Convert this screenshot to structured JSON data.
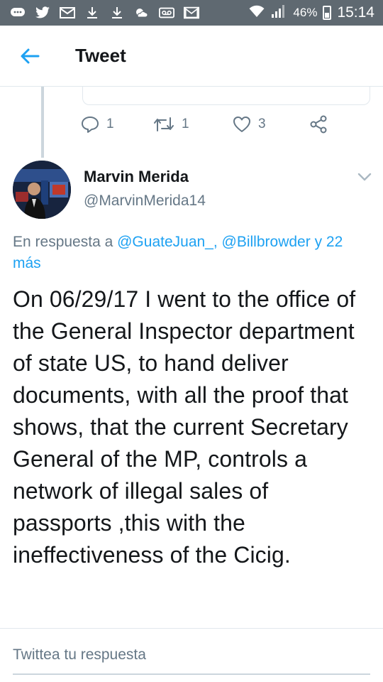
{
  "status_bar": {
    "icons": [
      "chat-icon",
      "twitter-bird-icon",
      "mail-icon",
      "download-icon",
      "download-icon",
      "weather-icon",
      "voicemail-icon",
      "gmail-icon"
    ],
    "battery": "46%",
    "time": "15:14"
  },
  "header": {
    "title": "Tweet"
  },
  "previous_tweet": {
    "reply_count": "1",
    "retweet_count": "1",
    "like_count": "3"
  },
  "tweet": {
    "author_name": "Marvin Merida",
    "author_handle": "@MarvinMerida14",
    "reply_prefix": "En respuesta a",
    "reply_user_1": "@GuateJuan_,",
    "reply_user_2": "@Billbrowder",
    "reply_more": "y 22 más",
    "text": "On 06/29/17 I went to the office of the General Inspector department of state US, to hand deliver documents, with all the proof that shows, that the current Secretary General of the MP, controls a network of illegal sales of passports ,this with the ineffectiveness of the Cicig."
  },
  "reply_field": {
    "placeholder": "Twittea tu respuesta"
  },
  "colors": {
    "status_bar": "#5f6971",
    "accent": "#1da1f2",
    "secondary_text": "#657786"
  }
}
